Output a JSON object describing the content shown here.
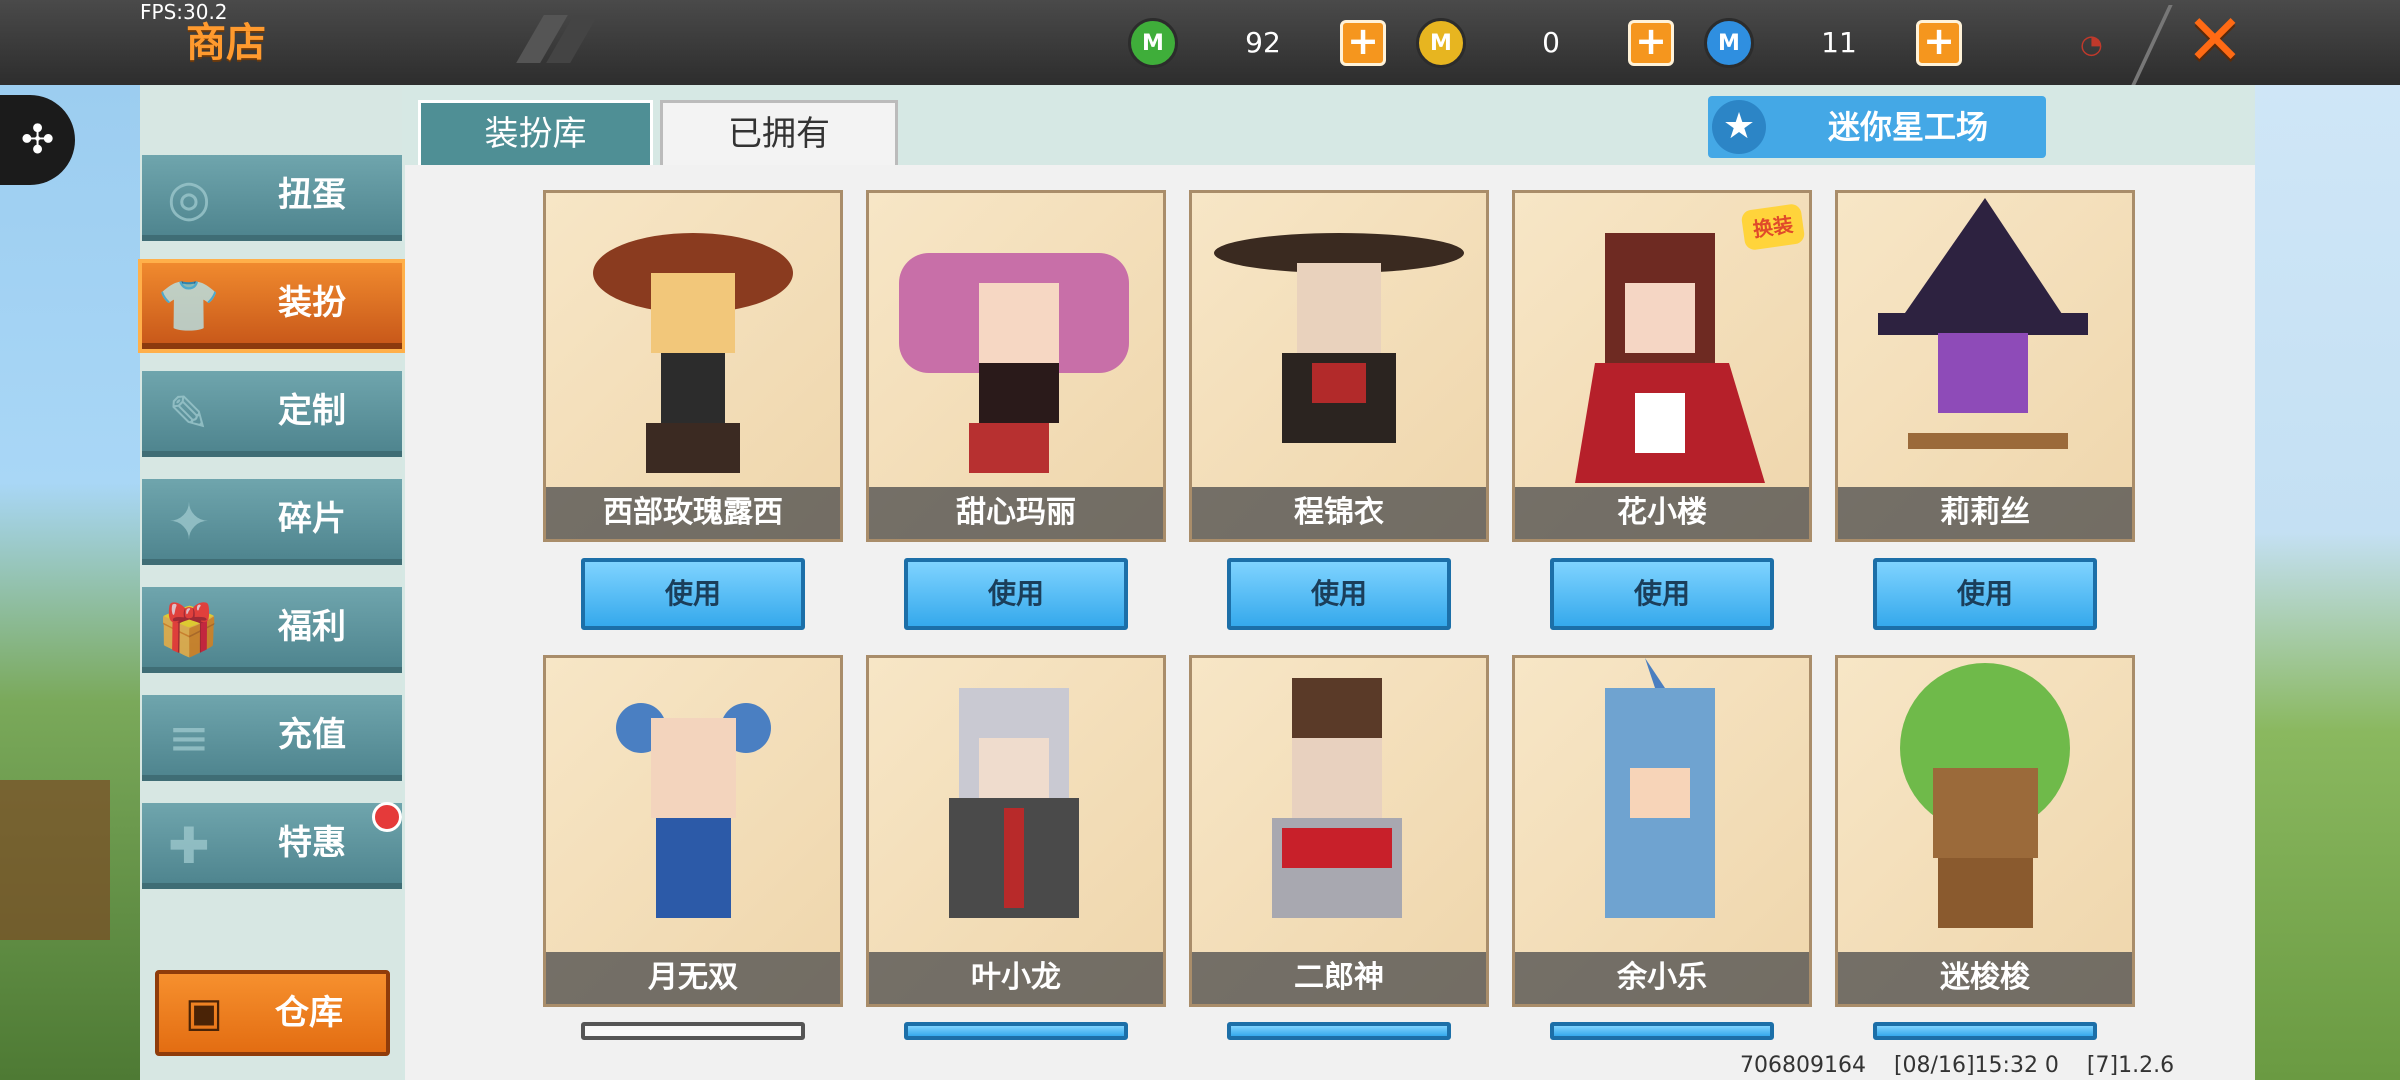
{
  "topbar": {
    "fps": "FPS:30.2",
    "title": "商店",
    "currencies": [
      {
        "icon": "green-mini-coin-icon",
        "value": "92",
        "color": "#3fae3a"
      },
      {
        "icon": "gold-mini-coin-icon",
        "value": "0",
        "color": "#e7b520"
      },
      {
        "icon": "blue-mini-coin-icon",
        "value": "11",
        "color": "#2f8fe0"
      }
    ],
    "plus": "+",
    "close": "✕"
  },
  "edge_tool": {
    "icon": "puzzle-icon",
    "glyph": "✣"
  },
  "sidebar": {
    "items": [
      {
        "label": "扭蛋",
        "icon": "gacha-icon",
        "glyph": "◎"
      },
      {
        "label": "装扮",
        "icon": "shirt-icon",
        "glyph": "👕"
      },
      {
        "label": "定制",
        "icon": "pencil-icon",
        "glyph": "✎"
      },
      {
        "label": "碎片",
        "icon": "fragment-icon",
        "glyph": "✦"
      },
      {
        "label": "福利",
        "icon": "gift-icon",
        "glyph": "🎁"
      },
      {
        "label": "充值",
        "icon": "coins-icon",
        "glyph": "≡"
      },
      {
        "label": "特惠",
        "icon": "offer-icon",
        "glyph": "✚"
      }
    ],
    "warehouse": {
      "label": "仓库",
      "icon": "chest-icon",
      "glyph": "▣"
    }
  },
  "tabs": {
    "library": "装扮库",
    "owned": "已拥有"
  },
  "workshop": {
    "label": "迷你星工场",
    "icon": "star-icon",
    "glyph": "★"
  },
  "use_label": "使用",
  "cards": [
    {
      "name": "西部玫瑰露西",
      "tag": ""
    },
    {
      "name": "甜心玛丽",
      "tag": ""
    },
    {
      "name": "程锦衣",
      "tag": ""
    },
    {
      "name": "花小楼",
      "tag": "换装"
    },
    {
      "name": "莉莉丝",
      "tag": ""
    },
    {
      "name": "月无双",
      "tag": ""
    },
    {
      "name": "叶小龙",
      "tag": ""
    },
    {
      "name": "二郎神",
      "tag": ""
    },
    {
      "name": "余小乐",
      "tag": ""
    },
    {
      "name": "迷梭梭",
      "tag": ""
    }
  ],
  "footer": {
    "uid": "706809164",
    "timestamp": "[08/16]15:32 0",
    "version": "[7]1.2.6"
  }
}
